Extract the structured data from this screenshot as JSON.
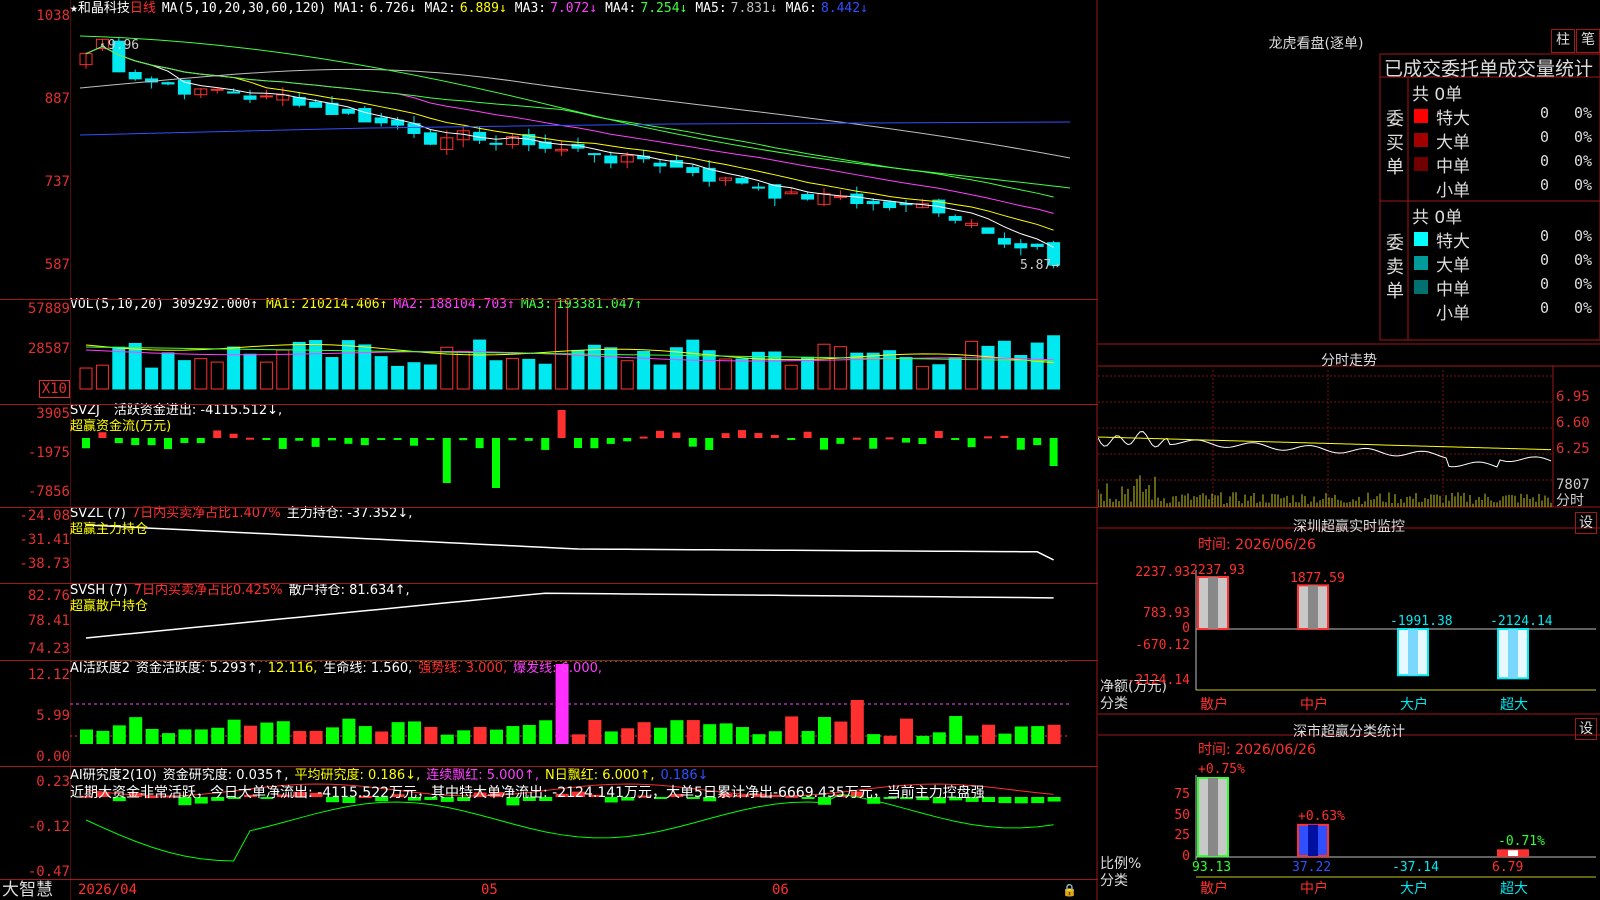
{
  "stock": {
    "star": "★",
    "name": "和晶科技",
    "period": "日线",
    "ma_label": "MA(5,10,20,30,60,120)",
    "ma": [
      {
        "label": "MA1:",
        "value": "6.726↓",
        "color": "#ffffff"
      },
      {
        "label": "MA2:",
        "value": "6.889↓",
        "color": "#ffff00"
      },
      {
        "label": "MA3:",
        "value": "7.072↓",
        "color": "#ff40ff"
      },
      {
        "label": "MA4:",
        "value": "7.254↓",
        "color": "#40ff40"
      },
      {
        "label": "MA5:",
        "value": "7.831↓",
        "color": "#c0c0c0"
      },
      {
        "label": "MA6:",
        "value": "8.442↓",
        "color": "#3050ff"
      }
    ],
    "high_marker": "9.96",
    "low_marker": "5.87"
  },
  "axes": {
    "price": [
      "1038",
      "887",
      "737",
      "587"
    ],
    "vol": [
      "57889",
      "28587",
      "X10"
    ],
    "svzj": [
      "3905",
      "-1975",
      "-7856"
    ],
    "svzl": [
      "-24.08",
      "-31.41",
      "-38.73"
    ],
    "svsh": [
      "82.76",
      "78.41",
      "74.23"
    ],
    "ai1": [
      "12.12",
      "5.99",
      "0.00"
    ],
    "ai2": [
      "0.23",
      "-0.12",
      "-0.47"
    ],
    "dates": [
      "2026/04",
      "05",
      "06"
    ]
  },
  "vol_header": {
    "label": "VOL(5,10,20)",
    "value": "309292.000↑",
    "ma": [
      {
        "label": "MA1:",
        "value": "210214.406↑",
        "color": "#ffff00"
      },
      {
        "label": "MA2:",
        "value": "188104.703↑",
        "color": "#ff40ff"
      },
      {
        "label": "MA3:",
        "value": "193381.047↑",
        "color": "#40ff40"
      }
    ]
  },
  "svzj_header": {
    "label": "SVZJ",
    "text": "活跃资金进出: -4115.512↓,",
    "sub": "超赢资金流(万元)"
  },
  "svzl_header": {
    "label": "SVZL (7)",
    "pct": "7日内买卖净占比1.407%",
    "text": "主力持仓: -37.352↓,",
    "sub": "超赢主力持仓"
  },
  "svsh_header": {
    "label": "SVSH (7)",
    "pct": "7日内买卖净占比0.425%",
    "text": "散户持仓: 81.634↑,",
    "sub": "超赢散户持仓"
  },
  "ai1_header": {
    "label": "AI活跃度2",
    "items": [
      {
        "text": "资金活跃度: 5.293↑,",
        "color": "#ffffff"
      },
      {
        "text": "12.116,",
        "color": "#ffff00"
      },
      {
        "text": "生命线: 1.560,",
        "color": "#ffffff"
      },
      {
        "text": "强势线: 3.000,",
        "color": "#ff3030"
      },
      {
        "text": "爆发线: 6.000,",
        "color": "#ff40ff"
      }
    ]
  },
  "ai2_header": {
    "label": "AI研究度2(10)",
    "items": [
      {
        "text": "资金研究度: 0.035↑,",
        "color": "#ffffff"
      },
      {
        "text": "平均研究度: 0.186↓,",
        "color": "#ffff00"
      },
      {
        "text": "连续飘红: 5.000↑,",
        "color": "#ff40ff"
      },
      {
        "text": "N日飘红: 6.000↑,",
        "color": "#ffff00"
      },
      {
        "text": "0.186↓",
        "color": "#3050ff"
      }
    ],
    "summary": "近期大资金非常活跃，今日大单净流出: -4115.522万元，其中特大单净流出: -2124.141万元，大单5日累计净出-6669.435万元，当前主力控盘强"
  },
  "brand": "大智慧",
  "right": {
    "lhb_title": "龙虎看盘(逐单)",
    "btn_zhu": "柱",
    "btn_bi": "笔",
    "subtitle": "已成交委托单成交量统计",
    "buy_label": "委买单",
    "sell_label": "委卖单",
    "buy_total": "共 0单",
    "sell_total": "共 0单",
    "buy_rows": [
      {
        "name": "特大",
        "count": "0",
        "pct": "0%",
        "color": "#ff0000"
      },
      {
        "name": "大单",
        "count": "0",
        "pct": "0%",
        "color": "#a00000"
      },
      {
        "name": "中单",
        "count": "0",
        "pct": "0%",
        "color": "#700000"
      },
      {
        "name": "小单",
        "count": "0",
        "pct": "0%",
        "color": ""
      }
    ],
    "sell_rows": [
      {
        "name": "特大",
        "count": "0",
        "pct": "0%",
        "color": "#00ffff"
      },
      {
        "name": "大单",
        "count": "0",
        "pct": "0%",
        "color": "#009a9a"
      },
      {
        "name": "中单",
        "count": "0",
        "pct": "0%",
        "color": "#007070"
      },
      {
        "name": "小单",
        "count": "0",
        "pct": "0%",
        "color": ""
      }
    ],
    "fenshi_title": "分时走势",
    "fenshi_axis": [
      "6.95",
      "6.60",
      "6.25",
      "7807",
      "分时"
    ],
    "monitor_title": "深圳超赢实时监控",
    "monitor_btn": "设",
    "monitor_time": "时间: 2026/06/26",
    "monitor_axis": [
      "2237.93",
      "783.93",
      "0",
      "-670.12",
      "-2124.14"
    ],
    "monitor_unit": "净额(万元)",
    "monitor_cat": "分类",
    "monitor_bars": [
      {
        "name": "散户",
        "value": 2237.93,
        "label": "2237.93"
      },
      {
        "name": "中户",
        "value": 1877.59,
        "label": "1877.59"
      },
      {
        "name": "大户",
        "value": -1991.38,
        "label": "-1991.38"
      },
      {
        "name": "超大",
        "value": -2124.14,
        "label": "-2124.14"
      }
    ],
    "stat_title": "深市超赢分类统计",
    "stat_btn": "设",
    "stat_time": "时间: 2026/06/26",
    "stat_axis": [
      "75",
      "50",
      "25",
      "0"
    ],
    "stat_unit": "比例%",
    "stat_cat": "分类",
    "stat_bars": [
      {
        "name": "散户",
        "value": 93.13,
        "label": "93.13",
        "top": "+0.75%"
      },
      {
        "name": "中户",
        "value": 37.22,
        "label": "37.22",
        "top": "+0.63%"
      },
      {
        "name": "大户",
        "value": -37.14,
        "label": "-37.14",
        "top": ""
      },
      {
        "name": "超大",
        "value": 6.79,
        "label": "6.79",
        "top": "-0.71%"
      }
    ]
  },
  "colors": {
    "up": "#ff3030",
    "down": "#00e8f0",
    "grid": "#a01818",
    "green": "#00ff00"
  }
}
